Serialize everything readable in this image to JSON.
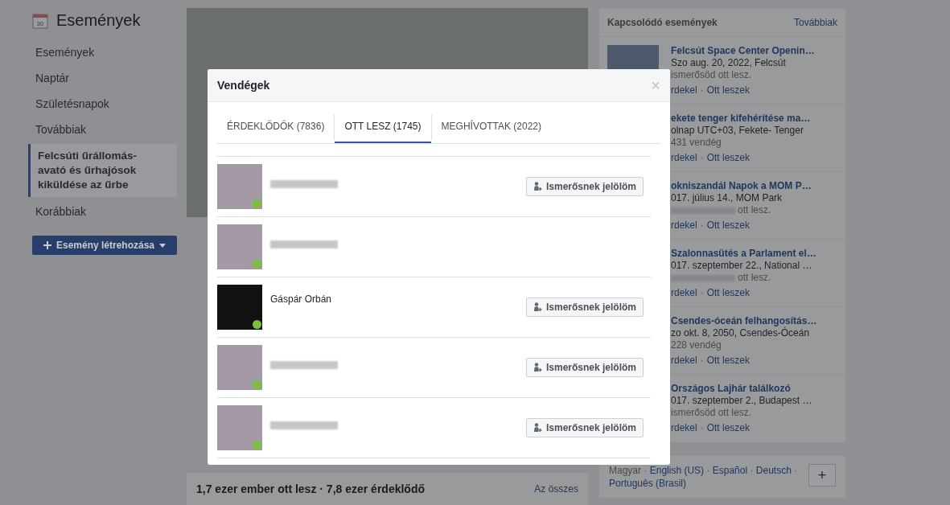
{
  "sidebar": {
    "title": "Események",
    "calendar_day": "30",
    "items": [
      {
        "label": "Események",
        "selected": false
      },
      {
        "label": "Naptár",
        "selected": false
      },
      {
        "label": "Születésnapok",
        "selected": false
      },
      {
        "label": "Továbbiak",
        "selected": false
      },
      {
        "label": "Felcsúti űrállomás-avató és űrhajósok kiküldése az űrbe",
        "selected": true
      },
      {
        "label": "Korábbiak",
        "selected": false
      }
    ],
    "create_button": "Esemény létrehozása"
  },
  "event": {
    "summary": "1,7 ezer ember ott lesz · 7,8 ezer érdeklődő",
    "see_all": "Az összes"
  },
  "related": {
    "title": "Kapcsolódó események",
    "more": "Továbbiak",
    "separator": "·",
    "items": [
      {
        "title": "Felcsút Space Center Openin…",
        "date": "Szo aug. 20, 2022, Felcsút",
        "kind": "text",
        "guests": "ismerősöd ott lesz.",
        "actions": [
          "rdekel",
          "Ott leszek"
        ],
        "thumbnail": true
      },
      {
        "title": "ekete tenger kifehérítése ma…",
        "date": "olnap UTC+03, Fekete- Tenger",
        "kind": "text",
        "guests": "431 vendég",
        "actions": [
          "rdekel",
          "Ott leszek"
        ],
        "thumbnail": false
      },
      {
        "title": "okniszandál Napok a MOM P…",
        "date": "017. július 14., MOM Park",
        "kind": "redacted",
        "guests": "ott lesz.",
        "actions": [
          "rdekel",
          "Ott leszek"
        ],
        "thumbnail": false
      },
      {
        "title": "Szalonnasütés a Parlament el…",
        "date": "017. szeptember 22., National …",
        "kind": "redacted",
        "guests": "ott lesz.",
        "actions": [
          "rdekel",
          "Ott leszek"
        ],
        "thumbnail": false
      },
      {
        "title": "Csendes-óceán felhangosítás…",
        "date": "zo okt. 8, 2050, Csendes-Óceán",
        "kind": "text",
        "guests": "228 vendég",
        "actions": [
          "rdekel",
          "Ott leszek"
        ],
        "thumbnail": false
      },
      {
        "title": "Országos Lajhár találkozó",
        "date": "017. szeptember 2., Budapest …",
        "kind": "text",
        "guests": "ismerősöd ott lesz.",
        "actions": [
          "rdekel",
          "Ott leszek"
        ],
        "thumbnail": false
      }
    ]
  },
  "languages": {
    "separator": "·",
    "items": [
      {
        "label": "Magyar",
        "selected": true
      },
      {
        "label": "English (US)",
        "selected": false
      },
      {
        "label": "Español",
        "selected": false
      },
      {
        "label": "Deutsch",
        "selected": false
      },
      {
        "label": "Português (Brasil)",
        "selected": false
      }
    ],
    "add_button": "+"
  },
  "modal": {
    "title": "Vendégek",
    "close": "×",
    "tabs": [
      {
        "label": "ÉRDEKLŐDŐK (7836)",
        "selected": false
      },
      {
        "label": "OTT LESZ (1745)",
        "selected": true
      },
      {
        "label": "MEGHÍVOTTAK (2022)",
        "selected": false
      }
    ],
    "guests": [
      {
        "kind": "redacted",
        "add_friend": "Ismerősnek jelölöm"
      },
      {
        "kind": "redacted"
      },
      {
        "kind": "named",
        "name": "Gáspár Orbán",
        "add_friend": "Ismerősnek jelölöm"
      },
      {
        "kind": "redacted",
        "add_friend": "Ismerősnek jelölöm"
      },
      {
        "kind": "redacted",
        "add_friend": "Ismerősnek jelölöm"
      }
    ]
  }
}
